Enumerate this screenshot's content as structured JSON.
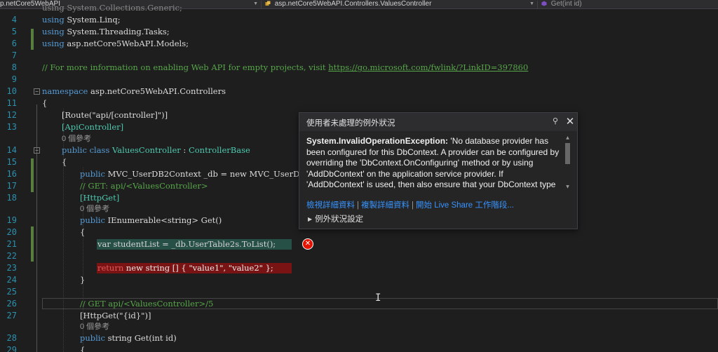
{
  "navbar": {
    "project": "p.netCore5WebAPI",
    "class_scope": "asp.netCore5WebAPI.Controllers.ValuesController",
    "member": "Get(int id)"
  },
  "lines": {
    "partial_top": "using System.Collections.Generic;",
    "l4": {
      "num": "4",
      "kw": "using",
      "rest": " System.Linq;"
    },
    "l5": {
      "num": "5",
      "kw": "using",
      "rest": " System.Threading.Tasks;"
    },
    "l6": {
      "num": "6",
      "kw": "using",
      "rest": " asp.netCore5WebAPI.Models;"
    },
    "l7": {
      "num": "7"
    },
    "l8": {
      "num": "8",
      "comment": "// For more information on enabling Web API for empty projects, visit ",
      "link": "https://go.microsoft.com/fwlink/?LinkID=397860"
    },
    "l9": {
      "num": "9"
    },
    "l10": {
      "num": "10",
      "kw": "namespace",
      "rest": " asp.netCore5WebAPI.Controllers"
    },
    "l11": {
      "num": "11",
      "text": "{"
    },
    "l12": {
      "num": "12",
      "text": "[Route(\"api/[controller]\")]"
    },
    "l13": {
      "num": "13",
      "text": "[ApiController]"
    },
    "lens1": "0 個參考",
    "l14": {
      "num": "14",
      "kw": "public class",
      "name": " ValuesController",
      "colon": " : ",
      "base": "ControllerBase"
    },
    "l15": {
      "num": "15",
      "text": "{"
    },
    "l16": {
      "num": "16",
      "kw": "public",
      "text": " MVC_UserDB2Context _db = new MVC_UserDB2Co"
    },
    "l17": {
      "num": "17",
      "comment": "// GET: api/<ValuesController>"
    },
    "l18": {
      "num": "18",
      "text": "[HttpGet]"
    },
    "lens2": "0 個參考",
    "l19": {
      "num": "19",
      "kw": "public",
      "text": " IEnumerable<string> Get()"
    },
    "l20": {
      "num": "20",
      "text": "{"
    },
    "l21": {
      "num": "21",
      "text": "var studentList = _db.UserTable2s.ToList();"
    },
    "l22": {
      "num": "22"
    },
    "l23": {
      "num": "23",
      "kw": "return",
      "text": " new string [] { \"value1\", \"value2\" };"
    },
    "l24": {
      "num": "24",
      "text": "}"
    },
    "l25": {
      "num": "25"
    },
    "l26": {
      "num": "26",
      "comment": "// GET api/<ValuesController>/5"
    },
    "l27": {
      "num": "27",
      "text": "[HttpGet(\"{id}\")]"
    },
    "lens3": "0 個參考",
    "l28": {
      "num": "28",
      "kw": "public",
      "text": " string Get(int id)"
    },
    "l29": {
      "num": "29",
      "text": "{"
    }
  },
  "exception_popup": {
    "title": "使用者未處理的例外狀況",
    "exception_type": "System.InvalidOperationException:",
    "message": " 'No database provider has been configured for this DbContext. A provider can be configured by overriding the 'DbContext.OnConfiguring' method or by using 'AddDbContext' on the application service provider. If 'AddDbContext' is used, then also ensure that your DbContext type accepts a DbContextOptions<TContext> object in its constructor and passes it to the base constructor for DbContext.'",
    "link_view_details": "檢視詳細資料",
    "link_copy_details": "複製詳細資料",
    "link_live_share": "開始 Live Share 工作階段...",
    "link_separator": "|",
    "settings_label": "例外狀況設定"
  },
  "colors": {
    "background": "#1e1e1e",
    "keyword": "#569cd6",
    "type": "#4ec9b0",
    "string": "#d69d85",
    "comment": "#57a64a",
    "error_highlight": "#7a1414",
    "current_statement": "#264f45",
    "link": "#3794ff"
  },
  "icons": [
    "csharp-file-icon",
    "class-icon",
    "method-icon",
    "pin-icon",
    "close-icon",
    "error-glyph-icon",
    "expand-triangle-icon"
  ]
}
